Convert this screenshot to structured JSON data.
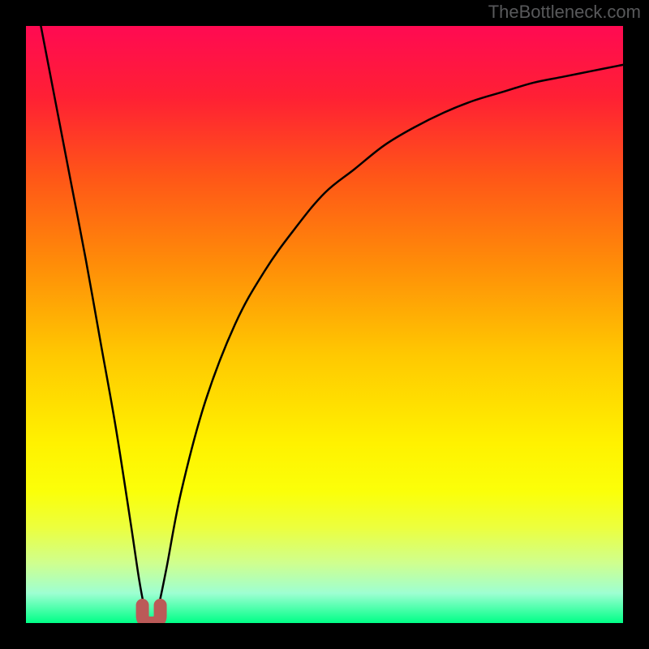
{
  "watermark": "TheBottleneck.com",
  "colors": {
    "frame": "#000000",
    "curve": "#000000",
    "nub": "#bb5a58",
    "gradient_stops": [
      {
        "pct": 0,
        "c": "#ff0a52"
      },
      {
        "pct": 12,
        "c": "#ff2034"
      },
      {
        "pct": 25,
        "c": "#ff5518"
      },
      {
        "pct": 40,
        "c": "#ff8d08"
      },
      {
        "pct": 55,
        "c": "#ffc801"
      },
      {
        "pct": 70,
        "c": "#fff200"
      },
      {
        "pct": 78,
        "c": "#fbff09"
      },
      {
        "pct": 84,
        "c": "#ecff3e"
      },
      {
        "pct": 90,
        "c": "#cfff8f"
      },
      {
        "pct": 95,
        "c": "#9effd2"
      },
      {
        "pct": 100,
        "c": "#00ff87"
      }
    ]
  },
  "chart_data": {
    "type": "line",
    "title": "",
    "xlabel": "",
    "ylabel": "",
    "xlim": [
      0,
      1
    ],
    "ylim": [
      0,
      1
    ],
    "annotations": [],
    "series": [
      {
        "name": "bottleneck-curve",
        "x": [
          0.025,
          0.05,
          0.075,
          0.1,
          0.125,
          0.15,
          0.175,
          0.19,
          0.2,
          0.21,
          0.22,
          0.235,
          0.26,
          0.3,
          0.35,
          0.4,
          0.45,
          0.5,
          0.55,
          0.6,
          0.65,
          0.7,
          0.75,
          0.8,
          0.85,
          0.9,
          0.95,
          1.0
        ],
        "y": [
          1.0,
          0.87,
          0.74,
          0.61,
          0.47,
          0.33,
          0.17,
          0.07,
          0.02,
          0.0,
          0.02,
          0.09,
          0.22,
          0.37,
          0.5,
          0.59,
          0.66,
          0.72,
          0.76,
          0.8,
          0.83,
          0.855,
          0.875,
          0.89,
          0.905,
          0.915,
          0.925,
          0.935
        ]
      }
    ],
    "marker": {
      "x": 0.21,
      "y": 0.0,
      "shape": "u",
      "color": "#bb5a58"
    }
  }
}
